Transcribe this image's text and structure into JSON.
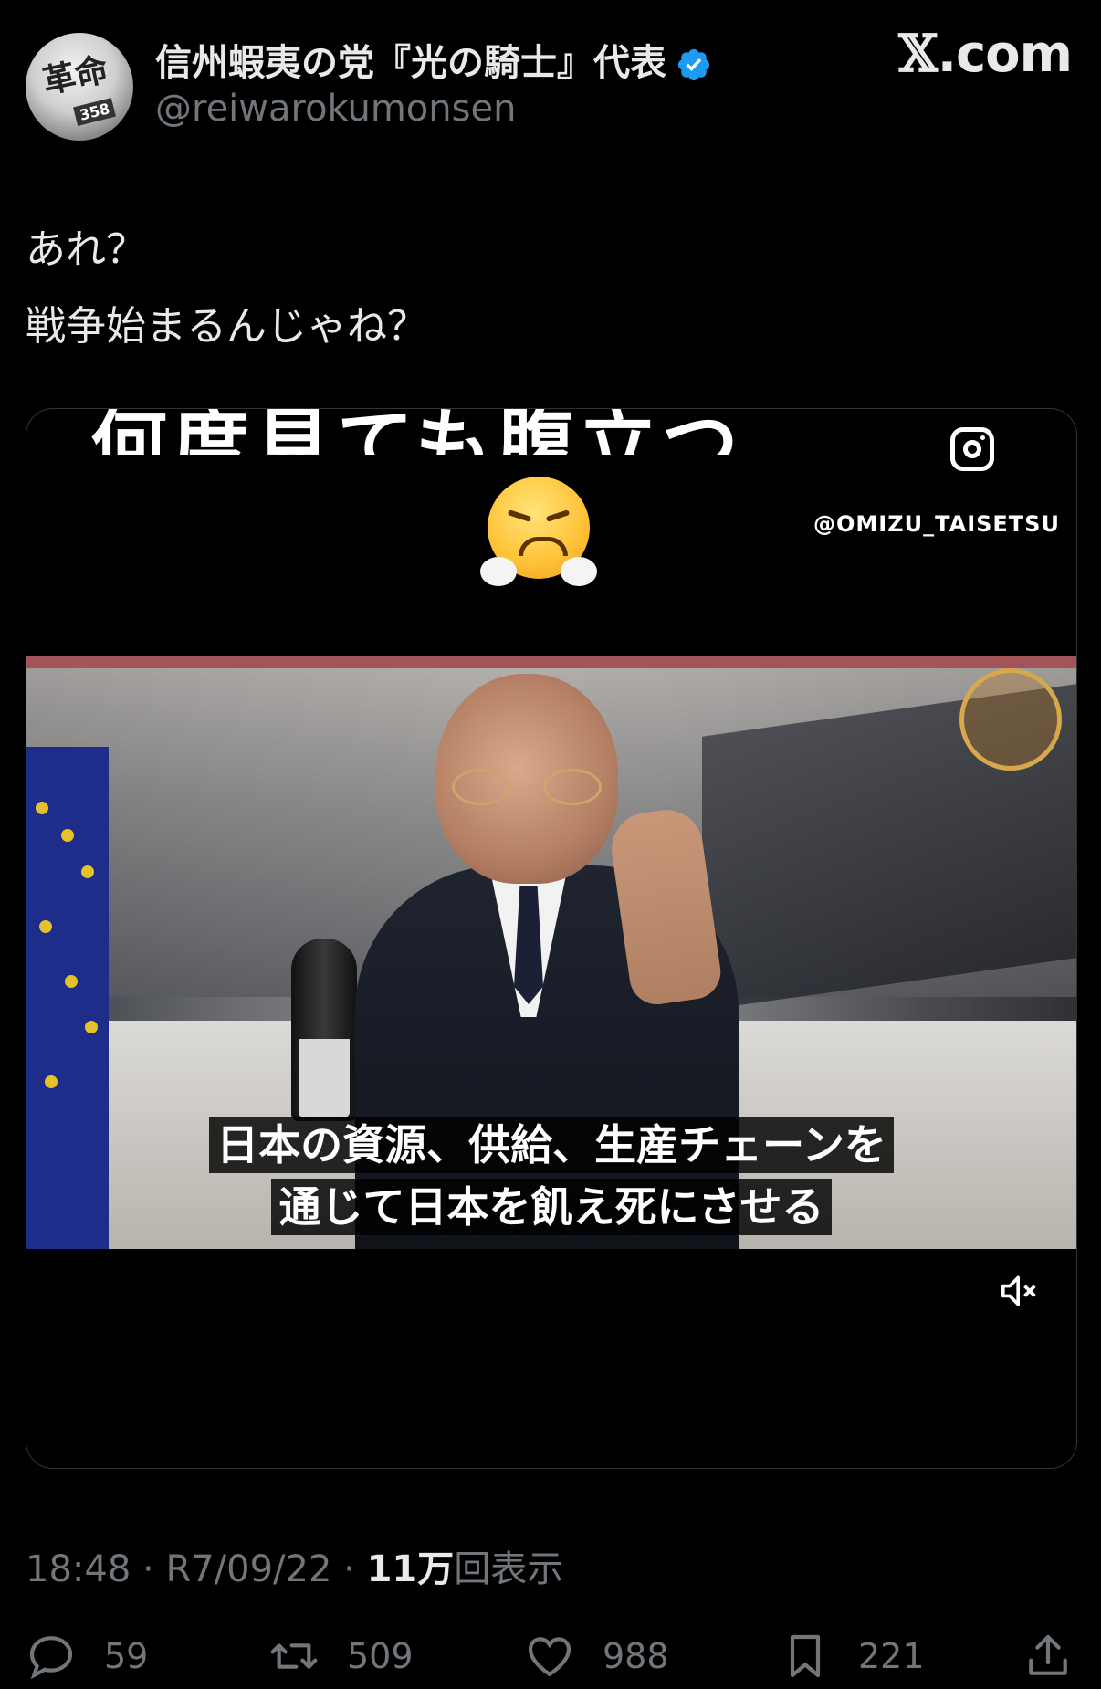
{
  "header": {
    "display_name": "信州蝦夷の党『光の騎士』代表",
    "handle": "@reiwarokumonsen",
    "brand": ".com",
    "avatar_text": "革命",
    "avatar_number": "358"
  },
  "tweet": {
    "line1": "あれ？",
    "line2": "戦争始まるんじゃね？"
  },
  "media": {
    "overlay_title": "何度見ても腹立つ",
    "instagram_handle": "@OMIZU_TAISETSU",
    "subtitle_line1": "日本の資源、供給、生産チェーンを",
    "subtitle_line2": "通じて日本を飢え死にさせる",
    "mute_icon": "muted-speaker-icon"
  },
  "meta": {
    "time": "18:48",
    "date": "R7/09/22",
    "views_count": "11万",
    "views_label": "回表示"
  },
  "actions": {
    "replies": "59",
    "reposts": "509",
    "likes": "988",
    "bookmarks": "221"
  },
  "colors": {
    "background": "#000000",
    "text_primary": "#e7e9ea",
    "text_secondary": "#71767b",
    "verified": "#1d9bf0"
  }
}
